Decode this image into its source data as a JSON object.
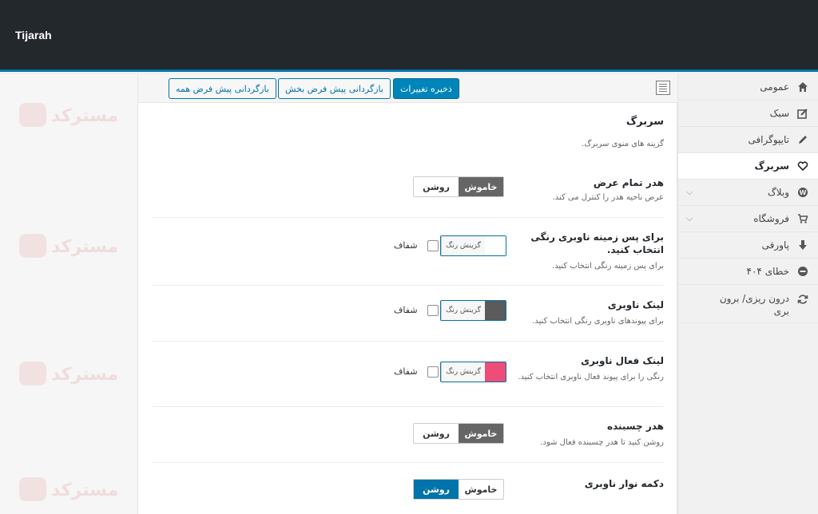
{
  "app": {
    "brand": "Tijarah"
  },
  "watermark": "مسترکد",
  "toolbar": {
    "save_label": "ذخیره تغییرات",
    "reset_section_label": "بازگردانی پیش فرض بخش",
    "reset_all_label": "بازگردانی پیش فرض همه"
  },
  "sidebar": {
    "items": [
      {
        "label": "عمومی",
        "icon": "home-icon"
      },
      {
        "label": "سبک",
        "icon": "edit-icon"
      },
      {
        "label": "تایپوگرافی",
        "icon": "pencil-icon"
      },
      {
        "label": "سربرگ",
        "icon": "heart-icon",
        "active": true
      },
      {
        "label": "وبلاگ",
        "icon": "wordpress-icon"
      },
      {
        "label": "فروشگاه",
        "icon": "cart-icon"
      },
      {
        "label": "پاورقی",
        "icon": "arrow-down-icon"
      },
      {
        "label": "خطای ۴۰۴",
        "icon": "minus-circle-icon"
      },
      {
        "label": "درون ریزی/ برون بری",
        "icon": "refresh-icon"
      }
    ]
  },
  "section": {
    "title": "سربرگ",
    "description": "گزینه های منوی سربرگ."
  },
  "settings": {
    "full_width_header": {
      "title": "هدر تمام عرض",
      "description": "عرض ناحیه هدر را کنترل می کند.",
      "off_label": "خاموش",
      "on_label": "روشن",
      "state": "off"
    },
    "nav_bg_color": {
      "title": "برای پس زمینه ناوبری رنگی انتخاب کنید.",
      "description": "برای پس زمینه رنگی انتخاب کنید.",
      "picker_label": "گزینش رنگ",
      "transparent_label": "شفاف",
      "color": "#ffffff"
    },
    "nav_link_color": {
      "title": "لینک ناوبری",
      "description": "برای پیوندهای ناوبری رنگی انتخاب کنید.",
      "picker_label": "گزینش رنگ",
      "transparent_label": "شفاف",
      "color": "#5b5b5b"
    },
    "nav_active_link_color": {
      "title": "لینک فعال ناوبری",
      "description": "رنگی را برای پیوند فعال ناوبری انتخاب کنید.",
      "picker_label": "گزینش رنگ",
      "transparent_label": "شفاف",
      "color": "#ee4d78"
    },
    "sticky_header": {
      "title": "هدر چسبنده",
      "description": "روشن کنید تا هدر چسبنده فعال شود.",
      "off_label": "خاموش",
      "on_label": "روشن",
      "state": "off"
    },
    "nav_bar_button": {
      "title": "دکمه نوار ناوبری",
      "off_label": "خاموش",
      "on_label": "روشن",
      "state": "on"
    }
  },
  "colors": {
    "accent": "#0073aa",
    "topbar": "#23282d"
  }
}
